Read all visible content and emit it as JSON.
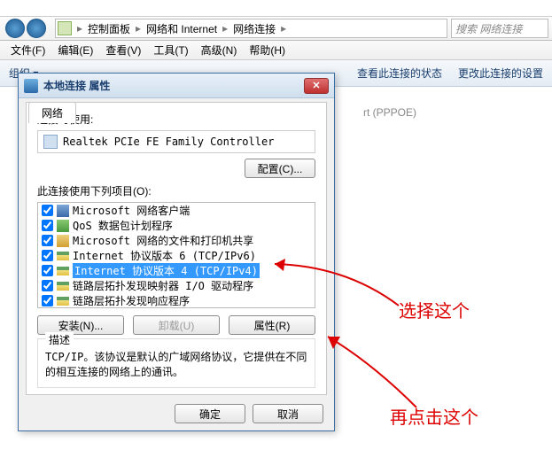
{
  "breadcrumb": {
    "segments": [
      "控制面板",
      "网络和 Internet",
      "网络连接"
    ],
    "search_placeholder": "搜索 网络连接"
  },
  "menubar": {
    "file": "文件(F)",
    "edit": "编辑(E)",
    "view": "查看(V)",
    "tools": "工具(T)",
    "advanced": "高级(N)",
    "help": "帮助(H)"
  },
  "toolbar": {
    "organize": "组织",
    "view_status": "查看此连接的状态",
    "change_settings": "更改此连接的设置"
  },
  "bg_text": "rt (PPPOE)",
  "dialog": {
    "title": "本地连接 属性",
    "tab_network": "网络",
    "connect_using_label": "连接时使用:",
    "adapter": "Realtek PCIe FE Family Controller",
    "configure_btn": "配置(C)...",
    "items_label": "此连接使用下列项目(O):",
    "items": [
      {
        "label": "Microsoft 网络客户端",
        "icon": "ic-client"
      },
      {
        "label": "QoS 数据包计划程序",
        "icon": "ic-qos"
      },
      {
        "label": "Microsoft 网络的文件和打印机共享",
        "icon": "ic-share"
      },
      {
        "label": "Internet 协议版本 6 (TCP/IPv6)",
        "icon": "ic-proto"
      },
      {
        "label": "Internet 协议版本 4 (TCP/IPv4)",
        "icon": "ic-proto",
        "selected": true
      },
      {
        "label": "链路层拓扑发现映射器 I/O 驱动程序",
        "icon": "ic-proto"
      },
      {
        "label": "链路层拓扑发现响应程序",
        "icon": "ic-proto"
      }
    ],
    "install_btn": "安装(N)...",
    "uninstall_btn": "卸载(U)",
    "properties_btn": "属性(R)",
    "desc_legend": "描述",
    "desc_text": "TCP/IP。该协议是默认的广域网络协议，它提供在不同的相互连接的网络上的通讯。",
    "ok_btn": "确定",
    "cancel_btn": "取消"
  },
  "annotations": {
    "select_this": "选择这个",
    "then_click": "再点击这个"
  }
}
